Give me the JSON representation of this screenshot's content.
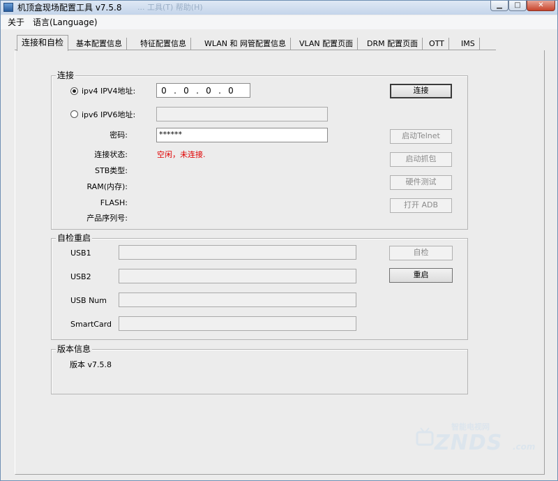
{
  "window": {
    "title": "机顶盒现场配置工具 v7.5.8",
    "title_ghost": "... 工具(T)    帮助(H)",
    "min_glyph": "▁",
    "max_glyph": "□",
    "close_glyph": "✕"
  },
  "menu": {
    "about": "关于",
    "language": "语言(Language)"
  },
  "tabs": [
    {
      "label": "连接和自检"
    },
    {
      "label": "基本配置信息"
    },
    {
      "label": "特征配置信息"
    },
    {
      "label": "WLAN 和 网管配置信息"
    },
    {
      "label": "VLAN 配置页面"
    },
    {
      "label": "DRM 配置页面"
    },
    {
      "label": "OTT"
    },
    {
      "label": "IMS"
    }
  ],
  "connect_group": {
    "title": "连接",
    "ipv4_label": "ipv4  IPV4地址:",
    "ipv4_octets": [
      "0",
      "0",
      "0",
      "0"
    ],
    "ipv4_dot": ".",
    "ipv6_label": "ipv6  IPV6地址:",
    "ipv6_value": "",
    "password_label": "密码:",
    "password_value": "******",
    "status_label": "连接状态:",
    "status_value": "空闲，未连接.",
    "stb_type_label": "STB类型:",
    "ram_label": "RAM(内存):",
    "flash_label": "FLASH:",
    "serial_label": "产品序列号:",
    "connect_button": "连接",
    "telnet_button": "启动Telnet",
    "capture_button": "启动抓包",
    "hwtest_button": "硬件测试",
    "adb_button": "打开 ADB"
  },
  "selftest_group": {
    "title": "自检重启",
    "usb1_label": "USB1",
    "usb2_label": "USB2",
    "usbnum_label": "USB Num",
    "smartcard_label": "SmartCard",
    "selftest_button": "自检",
    "reboot_button": "重启"
  },
  "version_group": {
    "title": "版本信息",
    "version_text": "版本 v7.5.8"
  },
  "watermark": {
    "top": "智能电视网",
    "brand": "ZNDS",
    "suffix": ".com"
  }
}
